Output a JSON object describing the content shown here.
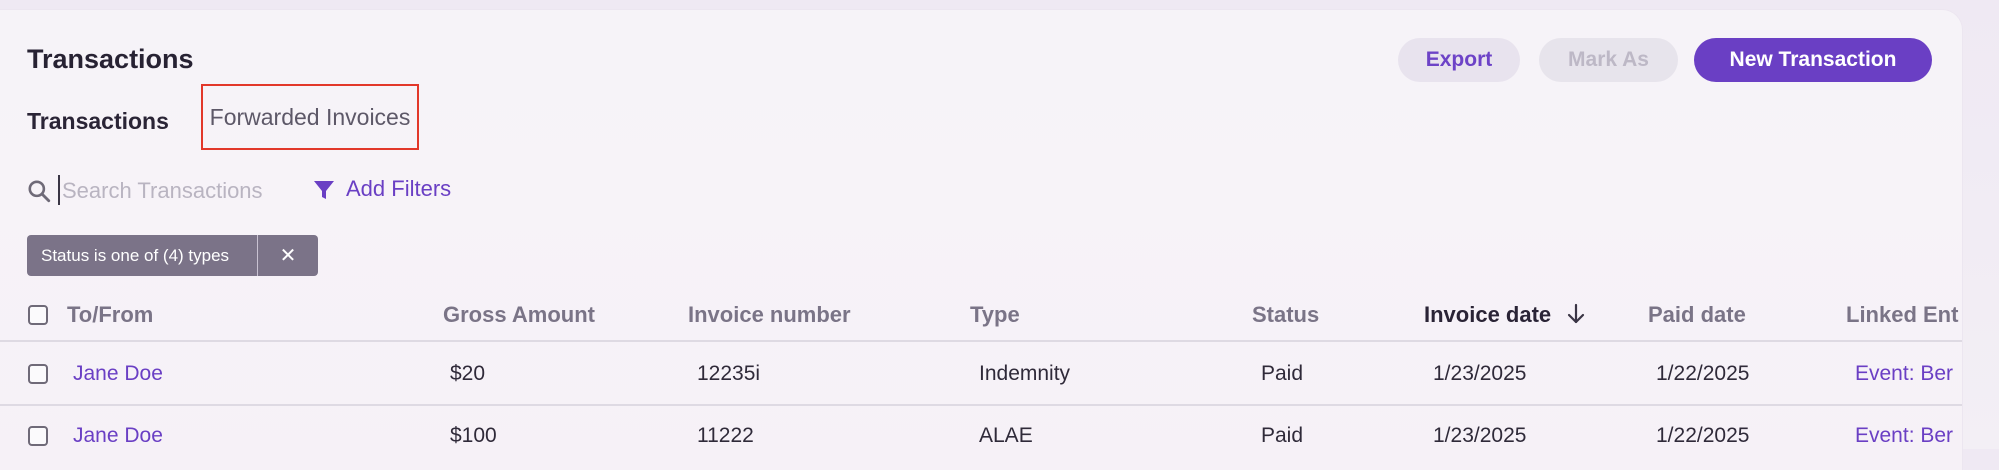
{
  "header": {
    "title": "Transactions",
    "export_label": "Export",
    "mark_as_label": "Mark As",
    "new_transaction_label": "New Transaction"
  },
  "tabs": {
    "transactions": "Transactions",
    "forwarded_invoices": "Forwarded Invoices"
  },
  "search": {
    "placeholder": "Search Transactions",
    "value": ""
  },
  "filters": {
    "add_label": "Add Filters",
    "chip_label": "Status is one of (4) types",
    "chip_close": "✕"
  },
  "table": {
    "columns": [
      "To/From",
      "Gross Amount",
      "Invoice number",
      "Type",
      "Status",
      "Invoice date",
      "Paid date",
      "Linked Ent"
    ],
    "sorted_column": "Invoice date",
    "rows": [
      {
        "to_from": "Jane Doe",
        "gross": "$20",
        "invoice_number": "12235i",
        "type": "Indemnity",
        "status": "Paid",
        "invoice_date": "1/23/2025",
        "paid_date": "1/22/2025",
        "linked": "Event: Ber"
      },
      {
        "to_from": "Jane Doe",
        "gross": "$100",
        "invoice_number": "11222",
        "type": "ALAE",
        "status": "Paid",
        "invoice_date": "1/23/2025",
        "paid_date": "1/22/2025",
        "linked": "Event: Ber"
      }
    ]
  },
  "colors": {
    "accent": "#6a3fc4",
    "chip_bg": "#7b7388",
    "highlight_box": "#e2372a"
  },
  "icons": [
    "search-icon",
    "filter-icon",
    "close-icon",
    "arrow-down-icon"
  ]
}
